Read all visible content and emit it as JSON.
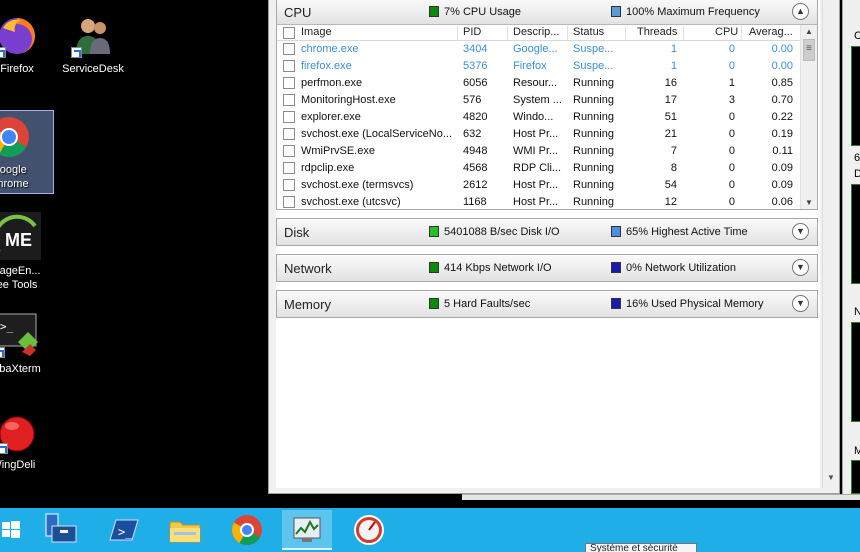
{
  "desktop": {
    "icons": [
      {
        "label": "Firefox"
      },
      {
        "label": "ServiceDesk"
      },
      {
        "label_line1": "Google",
        "label_line2": "Chrome"
      },
      {
        "label_line1": "nageEn...",
        "label_line2": "ee Tools"
      },
      {
        "label": "obaXterm"
      },
      {
        "label": "/ingDeli"
      }
    ]
  },
  "resmon": {
    "cpu": {
      "title": "CPU",
      "metric1": "7% CPU Usage",
      "metric1_color": "#0a8a0a",
      "metric2": "100% Maximum Frequency",
      "metric2_color": "#5b9bd5",
      "columns": {
        "image": "Image",
        "pid": "PID",
        "desc": "Descrip...",
        "status": "Status",
        "threads": "Threads",
        "cpu": "CPU",
        "avg": "Averag..."
      },
      "rows": [
        {
          "image": "chrome.exe",
          "pid": "3404",
          "desc": "Google...",
          "status": "Suspe...",
          "threads": "1",
          "cpu": "0",
          "avg": "0.00",
          "suspended": true
        },
        {
          "image": "firefox.exe",
          "pid": "5376",
          "desc": "Firefox",
          "status": "Suspe...",
          "threads": "1",
          "cpu": "0",
          "avg": "0.00",
          "suspended": true
        },
        {
          "image": "perfmon.exe",
          "pid": "6056",
          "desc": "Resour...",
          "status": "Running",
          "threads": "16",
          "cpu": "1",
          "avg": "0.85"
        },
        {
          "image": "MonitoringHost.exe",
          "pid": "576",
          "desc": "System ...",
          "status": "Running",
          "threads": "17",
          "cpu": "3",
          "avg": "0.70"
        },
        {
          "image": "explorer.exe",
          "pid": "4820",
          "desc": "Windo...",
          "status": "Running",
          "threads": "51",
          "cpu": "0",
          "avg": "0.22"
        },
        {
          "image": "svchost.exe (LocalServiceNo...",
          "pid": "632",
          "desc": "Host Pr...",
          "status": "Running",
          "threads": "21",
          "cpu": "0",
          "avg": "0.19"
        },
        {
          "image": "WmiPrvSE.exe",
          "pid": "4948",
          "desc": "WMI Pr...",
          "status": "Running",
          "threads": "7",
          "cpu": "0",
          "avg": "0.11"
        },
        {
          "image": "rdpclip.exe",
          "pid": "4568",
          "desc": "RDP Cli...",
          "status": "Running",
          "threads": "8",
          "cpu": "0",
          "avg": "0.09"
        },
        {
          "image": "svchost.exe (termsvcs)",
          "pid": "2612",
          "desc": "Host Pr...",
          "status": "Running",
          "threads": "54",
          "cpu": "0",
          "avg": "0.09"
        },
        {
          "image": "svchost.exe (utcsvc)",
          "pid": "1168",
          "desc": "Host Pr...",
          "status": "Running",
          "threads": "12",
          "cpu": "0",
          "avg": "0.06"
        }
      ]
    },
    "disk": {
      "title": "Disk",
      "metric1": "5401088 B/sec Disk I/O",
      "metric1_color": "#22c322",
      "metric2": "65% Highest Active Time",
      "metric2_color": "#4a8fe0"
    },
    "network": {
      "title": "Network",
      "metric1": "414 Kbps Network I/O",
      "metric1_color": "#0a8a0a",
      "metric2": "0% Network Utilization",
      "metric2_color": "#1a1ab0"
    },
    "memory": {
      "title": "Memory",
      "metric1": "5 Hard Faults/sec",
      "metric1_color": "#0a8a0a",
      "metric2": "16% Used Physical Memory",
      "metric2_color": "#1a1ab0"
    }
  },
  "right_panel": {
    "labels": [
      "C",
      "6",
      "D",
      "N",
      "M"
    ]
  },
  "taskbar": {
    "tooltip": "Système et sécurité"
  }
}
